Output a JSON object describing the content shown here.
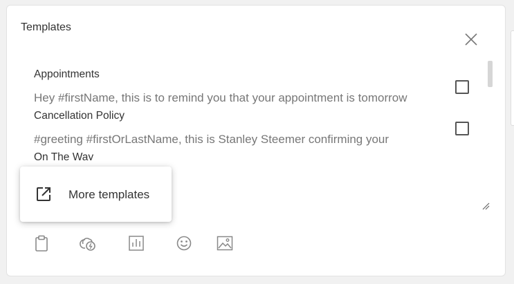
{
  "dialog": {
    "title": "Templates"
  },
  "templates": [
    {
      "name": "Appointments",
      "preview": "Hey #firstName, this is to remind you that your appointment is tomorrow",
      "checked": false
    },
    {
      "name": "Cancellation Policy",
      "preview": "#greeting #firstOrLastName, this is Stanley Steemer confirming your",
      "checked": false
    },
    {
      "name": "On The Way",
      "preview": "",
      "checked": false
    }
  ],
  "popup": {
    "label": "More templates",
    "icon": "open-in-new-icon"
  },
  "toolbar": {
    "icons": [
      "clipboard-icon",
      "payment-link-icon",
      "bar-chart-icon",
      "emoji-icon",
      "image-icon"
    ]
  },
  "colors": {
    "text": "#333333",
    "muted_text": "#777777",
    "icon_gray": "#888888",
    "border": "#e2e2e2",
    "background": "#f1f1f1"
  }
}
